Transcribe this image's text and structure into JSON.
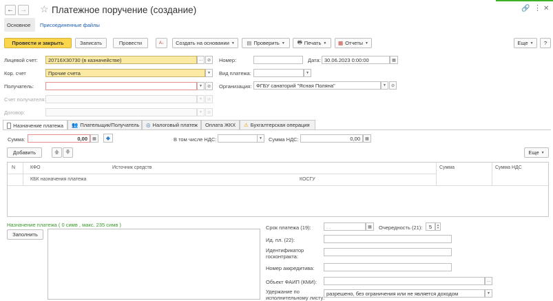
{
  "window": {
    "title": "Платежное поручение (создание)"
  },
  "header_tabs": {
    "main": "Основное",
    "attached": "Присоединенные файлы"
  },
  "toolbar": {
    "post_close": "Провести и закрыть",
    "save": "Записать",
    "post": "Провести",
    "create_based": "Создать на основании",
    "check": "Проверить",
    "print": "Печать",
    "reports": "Отчеты",
    "more": "Еще",
    "help": "?"
  },
  "form": {
    "account_label": "Лицевой счет:",
    "account_value": "20716Х30730 (в казначействе)",
    "number_label": "Номер:",
    "number_value": "",
    "date_label": "Дата:",
    "date_value": "30.06.2023  0:00:00",
    "cor_account_label": "Кор. счет",
    "cor_account_value": "Прочие счета",
    "payment_type_label": "Вид платежа:",
    "payment_type_value": "",
    "recipient_label": "Получатель:",
    "recipient_value": "",
    "org_label": "Организация:",
    "org_value": "ФГБУ санаторий \"Ясная Поляна\"",
    "recipient_account_label": "Счет получателя:",
    "contract_label": "Договор:"
  },
  "section_tabs": [
    {
      "label": "Назначение платежа"
    },
    {
      "label": "Плательщик/Получатель"
    },
    {
      "label": "Налоговый платеж"
    },
    {
      "label": "Оплата ЖКХ"
    },
    {
      "label": "Бухгалтерская операция"
    }
  ],
  "payment": {
    "sum_label": "Сумма:",
    "sum_value": "0,00",
    "vat_incl_label": "В том числе НДС:",
    "vat_incl_value": "",
    "vat_sum_label": "Сумма НДС:",
    "vat_sum_value": "0,00",
    "add_button": "Добавить",
    "more_button": "Еще"
  },
  "table": {
    "col_n": "N",
    "col_kfo": "КФО",
    "col_source": "Источник средств",
    "col_sum": "Сумма",
    "col_vat": "Сумма НДС",
    "col_kbk": "КБК назначения платежа",
    "col_kosgu": "КОСГУ"
  },
  "purpose": {
    "label": "Назначение платежа ( 0 симв , макс. 235 симв )",
    "fill_button": "Заполнить",
    "text": ""
  },
  "details": {
    "term_label": "Срок платежа (19):",
    "term_value": " .  .",
    "priority_label": "Очередность (21):",
    "priority_value": "5",
    "id_label": "Ид. пл. (22):",
    "contract_id_label_1": "Идентификатор",
    "contract_id_label_2": "госконтракта:",
    "accreditive_label": "Номер аккредитива:",
    "faip_label": "Объект ФАИП (КМИ):",
    "deduction_label_1": "Удержание по",
    "deduction_label_2": "исполнительному листу:",
    "deduction_value": "разрешено, без ограничения или не является доходом"
  },
  "colors": {
    "primary_button": "#fbd54a",
    "highlight_field": "#fbeaa4",
    "required_border": "#e98c8c",
    "link": "#1d5fb8",
    "counter_green": "#3a9a2a",
    "top_accent": "#3fae29"
  }
}
